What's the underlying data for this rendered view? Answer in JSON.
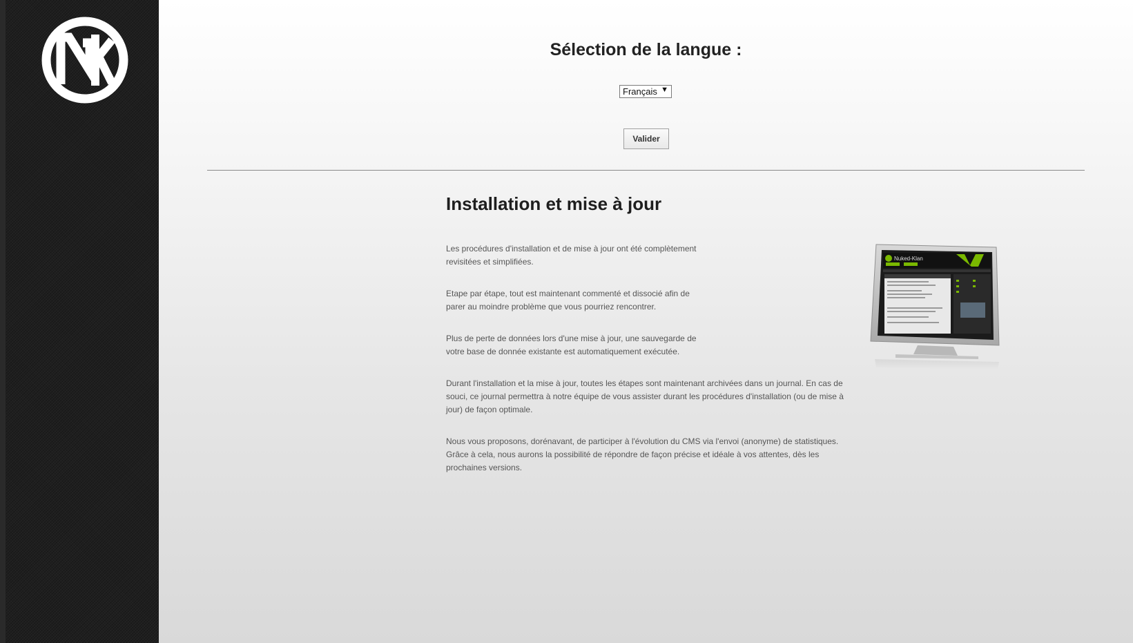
{
  "sidebar": {
    "logo_icon": "nk-logo-icon",
    "logo_letters": "NK"
  },
  "language": {
    "title": "Sélection de la langue :",
    "selected": "Français",
    "validate_label": "Valider"
  },
  "install": {
    "title": "Installation et mise à jour",
    "paragraphs": [
      "Les procédures d'installation et de mise à jour ont été complètement revisitées et simplifiées.",
      "Etape par étape, tout est maintenant commenté et dissocié afin de parer au moindre problème que vous pourriez rencontrer.",
      "Plus de perte de données lors d'une mise à jour, une sauvegarde de votre base de donnée existante est automatiquement exécutée.",
      "Durant l'installation et la mise à jour, toutes les étapes sont maintenant archivées dans un journal. En cas de souci, ce journal permettra à notre équipe de vous assister durant les procédures d'installation (ou de mise à jour) de façon optimale.",
      "Nous vous proposons, dorénavant, de participer à l'évolution du CMS via l'envoi (anonyme) de statistiques. Grâce à cela, nous aurons la possibilité de répondre de façon précise et idéale à vos attentes, dès les prochaines versions."
    ],
    "screenshot_brand": "Nuked-Klan"
  }
}
